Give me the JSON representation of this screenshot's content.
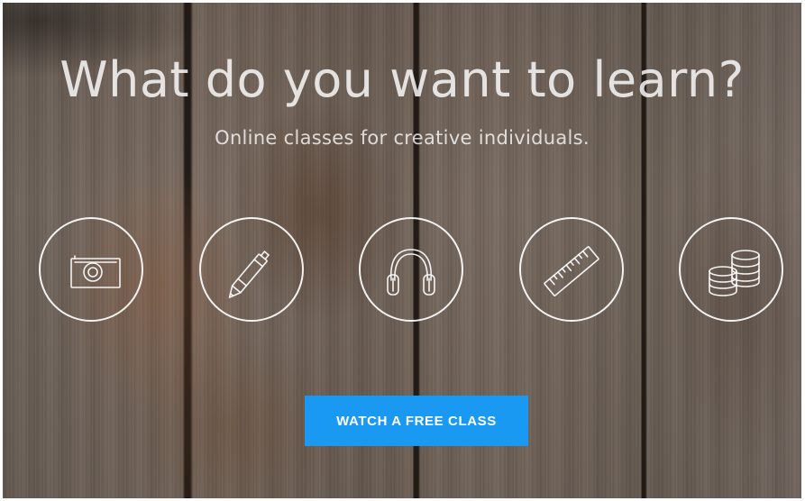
{
  "hero": {
    "headline": "What do you want to learn?",
    "subheadline": "Online classes for creative individuals.",
    "categories": [
      {
        "icon": "camera-icon"
      },
      {
        "icon": "pencil-icon"
      },
      {
        "icon": "headphones-icon"
      },
      {
        "icon": "ruler-icon"
      },
      {
        "icon": "coins-icon"
      }
    ],
    "cta_label": "WATCH A FREE CLASS"
  },
  "colors": {
    "cta_background": "#1a99f2",
    "text": "#ffffff"
  }
}
